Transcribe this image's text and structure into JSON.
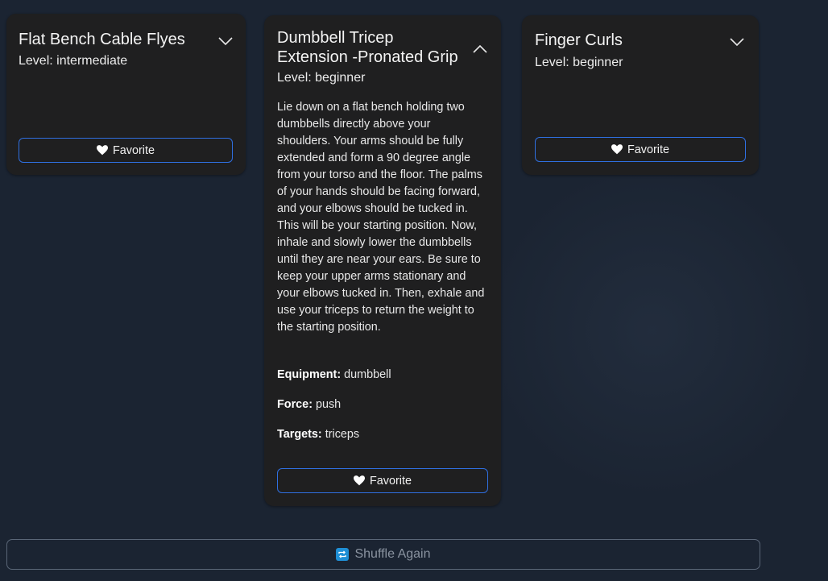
{
  "cards": [
    {
      "title": "Flat Bench Cable Flyes",
      "level": "Level: intermediate",
      "expanded": false,
      "favorite_label": "Favorite"
    },
    {
      "title_line1": "Dumbbell Tricep",
      "title_line2": "Extension -Pronated Grip",
      "level": "Level: beginner",
      "expanded": true,
      "description": "Lie down on a flat bench holding two dumbbells directly above your shoulders. Your arms should be fully extended and form a 90 degree angle from your torso and the floor. The palms of your hands should be facing forward, and your elbows should be tucked in. This will be your starting position. Now, inhale and slowly lower the dumbbells until they are near your ears. Be sure to keep your upper arms stationary and your elbows tucked in. Then, exhale and use your triceps to return the weight to the starting position.",
      "equipment_label": "Equipment:",
      "equipment_value": "dumbbell",
      "force_label": "Force:",
      "force_value": "push",
      "targets_label": "Targets:",
      "targets_value": "triceps",
      "favorite_label": "Favorite"
    },
    {
      "title": "Finger Curls",
      "level": "Level: beginner",
      "expanded": false,
      "favorite_label": "Favorite"
    }
  ],
  "shuffle": {
    "label": "Shuffle Again",
    "icon": "repeat-icon"
  },
  "colors": {
    "page_background": "#1b2432",
    "card_background": "#1f1f20",
    "button_border": "#2f6fe0",
    "shuffle_icon": "#1f8fd6"
  }
}
